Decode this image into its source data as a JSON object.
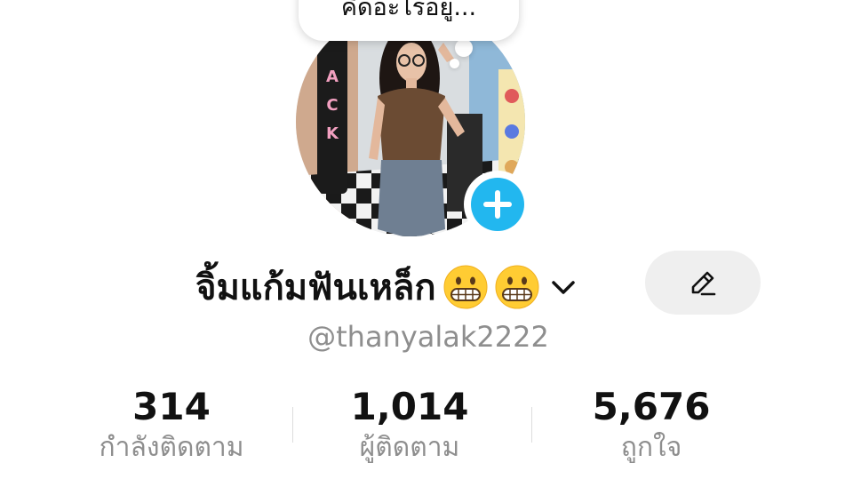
{
  "profile": {
    "note_text": "คิดอะไรอยู่...",
    "display_name": "จิ้มแก้มฟันเหล็ก",
    "username": "@thanyalak2222",
    "avatar_letters": [
      "A",
      "C",
      "K"
    ]
  },
  "stats": {
    "following_value": "314",
    "following_label": "กำลังติดตาม",
    "followers_value": "1,014",
    "followers_label": "ผู้ติดตาม",
    "likes_value": "5,676",
    "likes_label": "ถูกใจ"
  },
  "colors": {
    "accent_add_story": "#22b7ef",
    "text_primary": "#111111",
    "text_secondary": "#8e8e8e",
    "edit_button_bg": "#efefef"
  },
  "icons": {
    "add_story": "plus-icon",
    "chevron": "chevron-down-icon",
    "edit": "pencil-icon",
    "emoji": "grimacing-face-emoji"
  }
}
